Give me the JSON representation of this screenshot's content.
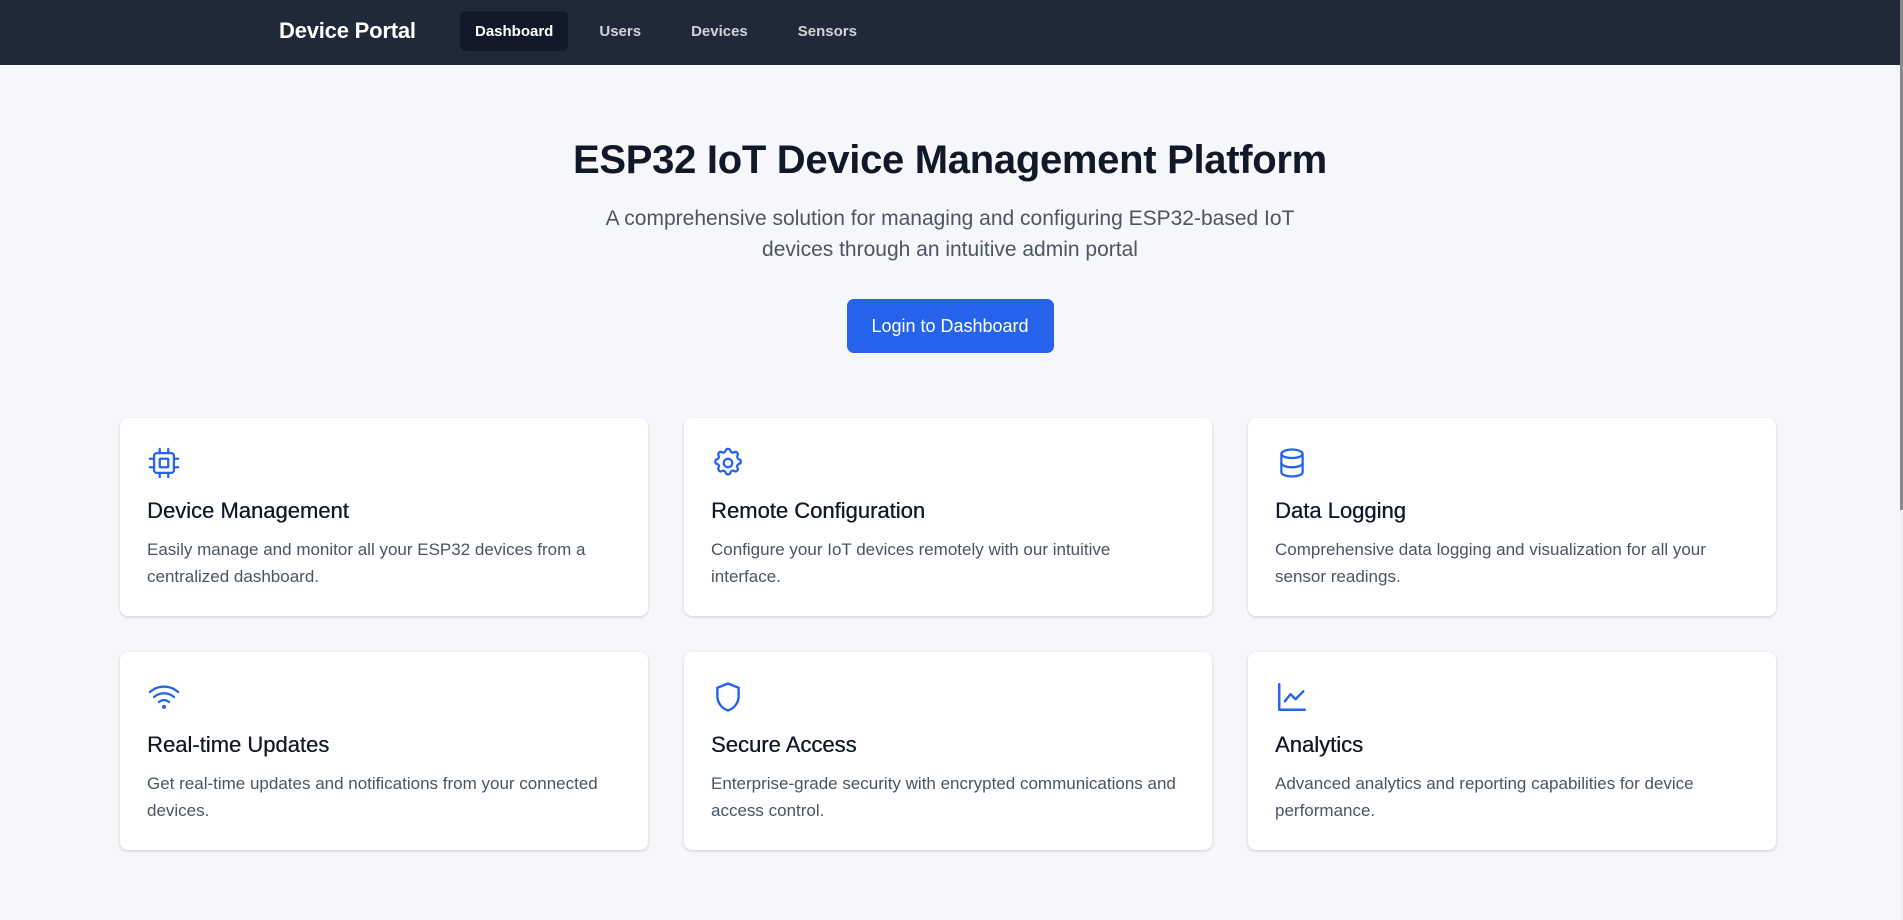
{
  "nav": {
    "brand": "Device Portal",
    "links": [
      {
        "label": "Dashboard",
        "active": true
      },
      {
        "label": "Users",
        "active": false
      },
      {
        "label": "Devices",
        "active": false
      },
      {
        "label": "Sensors",
        "active": false
      }
    ]
  },
  "hero": {
    "title": "ESP32 IoT Device Management Platform",
    "subtitle": "A comprehensive solution for managing and configuring ESP32-based IoT devices through an intuitive admin portal",
    "cta_label": "Login to Dashboard"
  },
  "features": [
    {
      "icon": "chip-icon",
      "title": "Device Management",
      "description": "Easily manage and monitor all your ESP32 devices from a centralized dashboard."
    },
    {
      "icon": "gear-icon",
      "title": "Remote Configuration",
      "description": "Configure your IoT devices remotely with our intuitive interface."
    },
    {
      "icon": "database-icon",
      "title": "Data Logging",
      "description": "Comprehensive data logging and visualization for all your sensor readings."
    },
    {
      "icon": "wifi-icon",
      "title": "Real-time Updates",
      "description": "Get real-time updates and notifications from your connected devices."
    },
    {
      "icon": "shield-icon",
      "title": "Secure Access",
      "description": "Enterprise-grade security with encrypted communications and access control."
    },
    {
      "icon": "chart-icon",
      "title": "Analytics",
      "description": "Advanced analytics and reporting capabilities for device performance."
    }
  ],
  "colors": {
    "navbar_bg": "#1f2937",
    "page_bg": "#f5f7fa",
    "accent": "#2563eb",
    "title_text": "#111827",
    "body_text": "#4b5563"
  }
}
